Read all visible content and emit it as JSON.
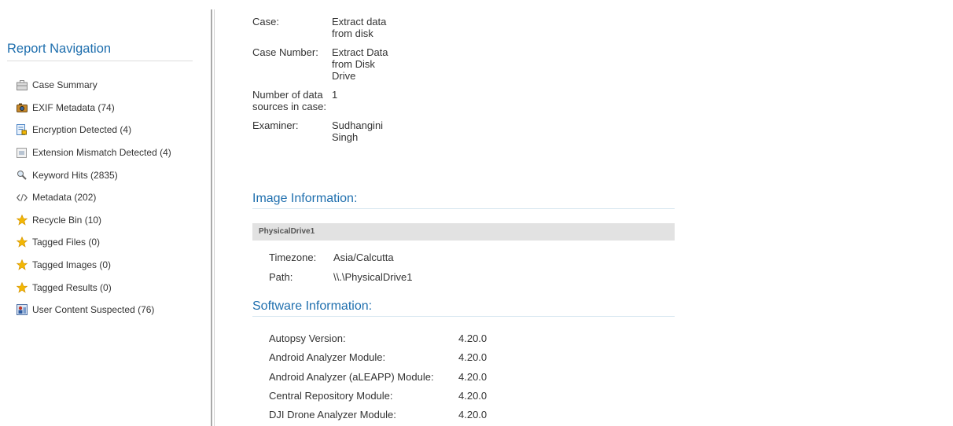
{
  "nav": {
    "title": "Report Navigation",
    "items": [
      {
        "label": "Case Summary",
        "icon": "briefcase-icon"
      },
      {
        "label": "EXIF Metadata (74)",
        "icon": "camera-icon"
      },
      {
        "label": "Encryption Detected (4)",
        "icon": "lock-file-icon"
      },
      {
        "label": "Extension Mismatch Detected (4)",
        "icon": "mismatch-icon"
      },
      {
        "label": "Keyword Hits (2835)",
        "icon": "magnifier-icon"
      },
      {
        "label": "Metadata (202)",
        "icon": "code-icon"
      },
      {
        "label": "Recycle Bin (10)",
        "icon": "star-icon"
      },
      {
        "label": "Tagged Files (0)",
        "icon": "star-icon"
      },
      {
        "label": "Tagged Images (0)",
        "icon": "star-icon"
      },
      {
        "label": "Tagged Results (0)",
        "icon": "star-icon"
      },
      {
        "label": "User Content Suspected (76)",
        "icon": "user-content-icon"
      }
    ]
  },
  "case": {
    "case_label": "Case:",
    "case_value": "Extract data from disk",
    "number_label": "Case Number:",
    "number_value": "Extract Data from Disk Drive",
    "sources_label": "Number of data sources in case:",
    "sources_value": "1",
    "examiner_label": "Examiner:",
    "examiner_value": "Sudhangini Singh"
  },
  "image": {
    "title": "Image Information:",
    "drive": "PhysicalDrive1",
    "timezone_label": "Timezone:",
    "timezone_value": "Asia/Calcutta",
    "path_label": "Path:",
    "path_value": "\\\\.\\PhysicalDrive1"
  },
  "software": {
    "title": "Software Information:",
    "rows": [
      {
        "label": "Autopsy Version:",
        "value": "4.20.0"
      },
      {
        "label": "Android Analyzer Module:",
        "value": "4.20.0"
      },
      {
        "label": "Android Analyzer (aLEAPP) Module:",
        "value": "4.20.0"
      },
      {
        "label": "Central Repository Module:",
        "value": "4.20.0"
      },
      {
        "label": "DJI Drone Analyzer Module:",
        "value": "4.20.0"
      }
    ]
  },
  "colors": {
    "accent": "#1f6fae",
    "star": "#f2b705",
    "header_bar": "#e2e2e2"
  }
}
